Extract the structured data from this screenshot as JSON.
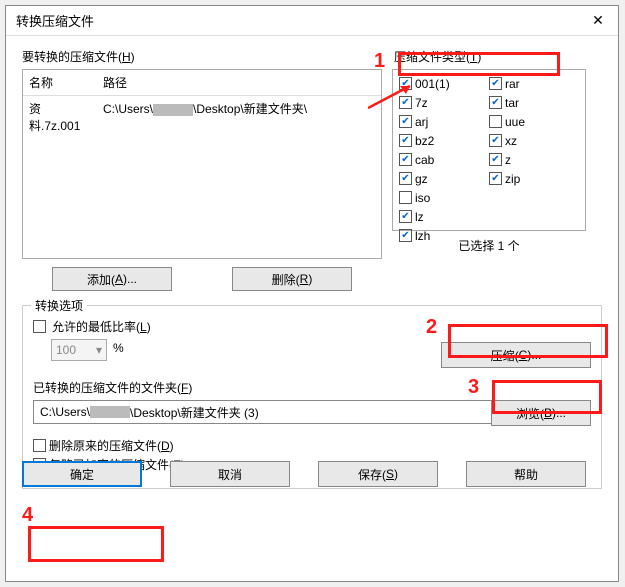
{
  "title": "转换压缩文件",
  "labels": {
    "filesToConvert": "要转换的压缩文件(",
    "filesToConvertKey": "H",
    "archiveTypes": "压缩文件类型(",
    "archiveTypesKey": "T",
    "colName": "名称",
    "colPath": "路径",
    "add": "添加(",
    "addKey": "A",
    "addSuffix": ")...",
    "remove": "删除(",
    "removeKey": "R",
    "removeSuffix": ")",
    "selectedCount": "已选择 1 个",
    "options": "转换选项",
    "minRatio": "允许的最低比率(",
    "minRatioKey": "L",
    "percent": "%",
    "spinVal": "100",
    "convertedFolder": "已转换的压缩文件的文件夹(",
    "convertedFolderKey": "F",
    "compress": "压缩(",
    "compressKey": "C",
    "compressSuffix": ")...",
    "browse": "浏览(",
    "browseKey": "B",
    "browseSuffix": ")...",
    "deleteOrig": "删除原来的压缩文件(",
    "deleteOrigKey": "D",
    "ignoreEnc": "忽略已加密的压缩文件(",
    "ignoreEncKey": "E",
    "ok": "确定",
    "cancel": "取消",
    "save": "保存(",
    "saveKey": "S",
    "help": "帮助"
  },
  "fileRow": {
    "name": "资料.7z.001",
    "pathPrefix": "C:\\Users\\",
    "pathSuffix": "\\Desktop\\新建文件夹\\"
  },
  "folderPath": {
    "prefix": "C:\\Users\\",
    "suffix": "\\Desktop\\新建文件夹 (3)"
  },
  "types": {
    "left": [
      {
        "label": "001(1)",
        "checked": true
      },
      {
        "label": "7z",
        "checked": true
      },
      {
        "label": "arj",
        "checked": true
      },
      {
        "label": "bz2",
        "checked": true
      },
      {
        "label": "cab",
        "checked": true
      },
      {
        "label": "gz",
        "checked": true
      },
      {
        "label": "iso",
        "checked": false
      },
      {
        "label": "lz",
        "checked": true
      },
      {
        "label": "lzh",
        "checked": true
      }
    ],
    "right": [
      {
        "label": "rar",
        "checked": true
      },
      {
        "label": "tar",
        "checked": true
      },
      {
        "label": "uue",
        "checked": false
      },
      {
        "label": "xz",
        "checked": true
      },
      {
        "label": "z",
        "checked": true
      },
      {
        "label": "zip",
        "checked": true
      }
    ]
  },
  "annotations": {
    "a1": "1",
    "a2": "2",
    "a3": "3",
    "a4": "4"
  }
}
